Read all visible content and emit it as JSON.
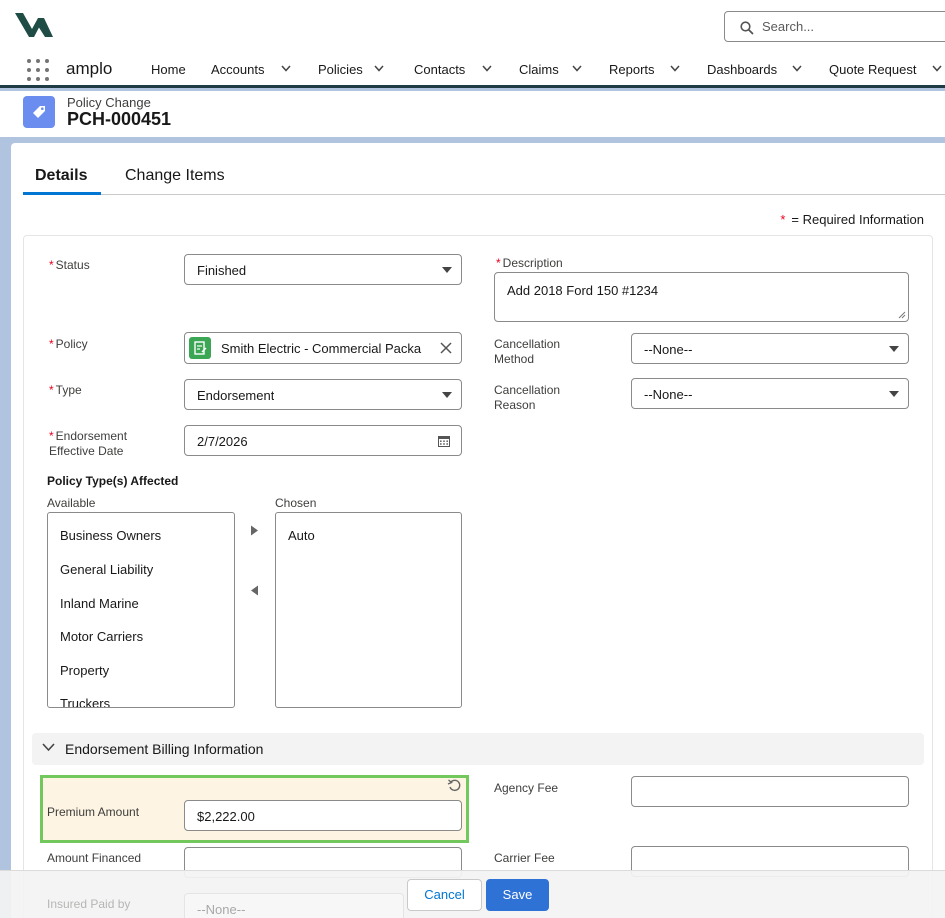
{
  "app": {
    "name": "amplo"
  },
  "search": {
    "placeholder": "Search..."
  },
  "nav": {
    "home": "Home",
    "accounts": "Accounts",
    "policies": "Policies",
    "contacts": "Contacts",
    "claims": "Claims",
    "reports": "Reports",
    "dashboards": "Dashboards",
    "quote_request": "Quote Request"
  },
  "record": {
    "object_label": "Policy Change",
    "name": "PCH-000451"
  },
  "tabs": {
    "details": "Details",
    "change_items": "Change Items"
  },
  "required_note": {
    "star": "*",
    "text": "= Required Information"
  },
  "form": {
    "status": {
      "label": "Status",
      "value": "Finished"
    },
    "description": {
      "label": "Description",
      "value": "Add 2018 Ford 150 #1234"
    },
    "policy": {
      "label": "Policy",
      "value": "Smith Electric - Commercial Packa"
    },
    "cancellation_method": {
      "label_1": "Cancellation",
      "label_2": "Method",
      "value": "--None--"
    },
    "type": {
      "label": "Type",
      "value": "Endorsement"
    },
    "cancellation_reason": {
      "label_1": "Cancellation",
      "label_2": "Reason",
      "value": "--None--"
    },
    "endorsement_date": {
      "label_1": "Endorsement",
      "label_2": "Effective Date",
      "value": "2/7/2026"
    },
    "policy_types": {
      "title": "Policy Type(s) Affected",
      "available_label": "Available",
      "chosen_label": "Chosen",
      "available": [
        "Business Owners",
        "General Liability",
        "Inland Marine",
        "Motor Carriers",
        "Property",
        "Truckers"
      ],
      "chosen": [
        "Auto"
      ]
    },
    "billing_section": "Endorsement Billing Information",
    "premium_amount": {
      "label": "Premium Amount",
      "value": "$2,222.00"
    },
    "agency_fee": {
      "label": "Agency Fee",
      "value": ""
    },
    "amount_financed": {
      "label": "Amount Financed",
      "value": ""
    },
    "carrier_fee": {
      "label": "Carrier Fee",
      "value": ""
    },
    "insured_paid_by": {
      "label": "Insured Paid by",
      "value": "--None--"
    }
  },
  "footer": {
    "cancel": "Cancel",
    "save": "Save"
  },
  "colors": {
    "brand": "#0176d3",
    "save_button": "#2f72d6",
    "highlight_border": "#72c75d",
    "required": "#ea001e"
  }
}
